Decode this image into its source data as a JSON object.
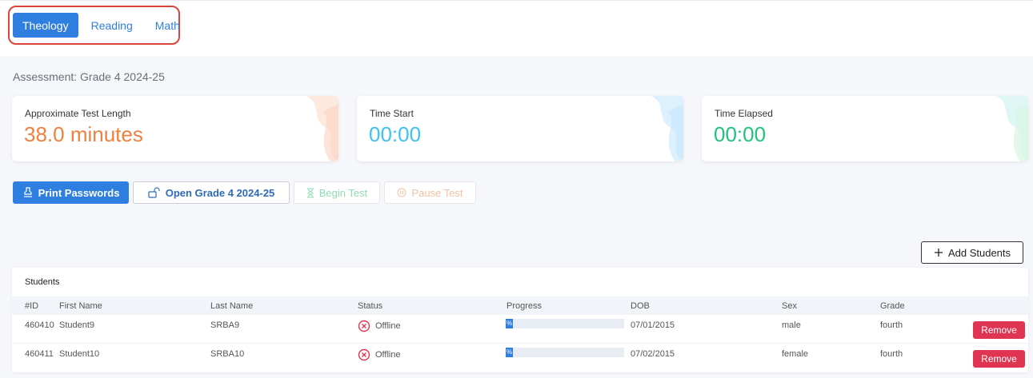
{
  "tabs": [
    {
      "label": "Theology",
      "active": true
    },
    {
      "label": "Reading",
      "active": false
    },
    {
      "label": "Math",
      "active": false
    }
  ],
  "assessment": "Assessment: Grade 4 2024-25",
  "cards": {
    "test_length": {
      "label": "Approximate Test Length",
      "value": "38.0 minutes",
      "color": "#f08040"
    },
    "time_start": {
      "label": "Time Start",
      "value": "00:00",
      "color": "#3ec3ee"
    },
    "time_elapsed": {
      "label": "Time Elapsed",
      "value": "00:00",
      "color": "#1fc47a"
    }
  },
  "actions": {
    "print": "Print Passwords",
    "open": "Open Grade 4 2024-25",
    "begin": "Begin Test",
    "pause": "Pause Test"
  },
  "add_students": "Add Students",
  "students": {
    "title": "Students",
    "columns": [
      "#ID",
      "First Name",
      "Last Name",
      "Status",
      "Progress",
      "DOB",
      "Sex",
      "Grade"
    ],
    "rows": [
      {
        "id": "460410",
        "first": "Student9",
        "last": "SRBA9",
        "status": "Offline",
        "progress": 0,
        "progress_label": "%",
        "dob": "07/01/2015",
        "sex": "male",
        "grade": "fourth",
        "action": "Remove"
      },
      {
        "id": "460411",
        "first": "Student10",
        "last": "SRBA10",
        "status": "Offline",
        "progress": 0,
        "progress_label": "%",
        "dob": "07/02/2015",
        "sex": "female",
        "grade": "fourth",
        "action": "Remove"
      }
    ]
  },
  "colors": {
    "primary": "#2f7fe0",
    "danger": "#e03552",
    "offline": "#e03552"
  }
}
